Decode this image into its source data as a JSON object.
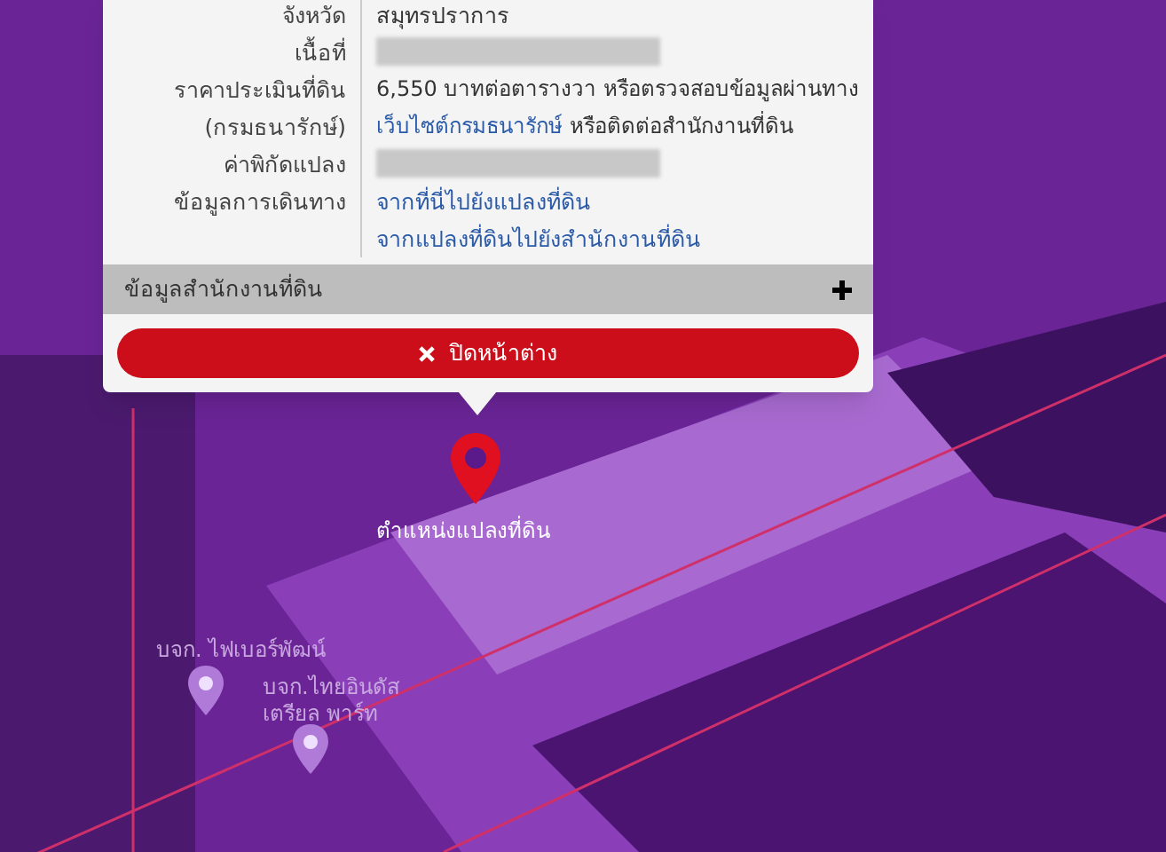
{
  "popup": {
    "rows": [
      {
        "kind": "text",
        "label": "จังหวัด",
        "value": "สมุทรปราการ"
      },
      {
        "kind": "redacted",
        "label": "เนื้อที่"
      },
      {
        "kind": "price",
        "label": "ราคาประเมินที่ดิน",
        "label2": "(กรมธนารักษ์)",
        "before": "6,550 บาทต่อตารางวา หรือตรวจสอบข้อมูลผ่านทาง",
        "link": "เว็บไซต์กรมธนารักษ์",
        "after": "หรือติดต่อสำนักงานที่ดิน"
      },
      {
        "kind": "redacted",
        "label": "ค่าพิกัดแปลง"
      },
      {
        "kind": "links",
        "label": "ข้อมูลการเดินทาง",
        "links": [
          "จากที่นี่ไปยังแปลงที่ดิน",
          "จากแปลงที่ดินไปยังสำนักงานที่ดิน"
        ]
      }
    ],
    "section": {
      "title": "ข้อมูลสำนักงานที่ดิน",
      "expanded": false
    },
    "close_button": "ปิดหน้าต่าง"
  },
  "map": {
    "pin_label": "ตำแหน่งแปลงที่ดิน",
    "places": [
      {
        "name": "บจก. ไฟเบอร์พัฒน์"
      },
      {
        "name": "บจก.ไทยอินดัส เตรียล พาร์ท"
      }
    ]
  }
}
